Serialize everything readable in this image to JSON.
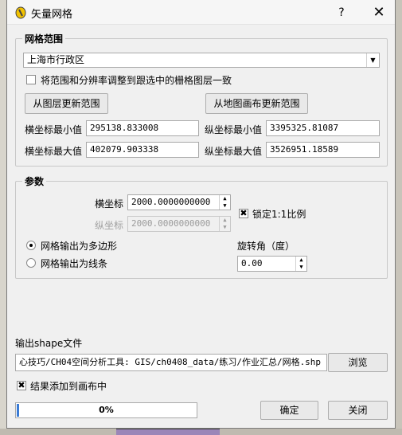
{
  "window": {
    "title": "矢量网格"
  },
  "titlebar": {
    "help_label": "?",
    "close_label": "✕"
  },
  "extent": {
    "group_title": "网格范围",
    "layer_combo_value": "上海市行政区",
    "match_raster_label": "将范围和分辨率调整到跟选中的栅格图层一致",
    "match_raster_checked": false,
    "update_from_layer_label": "从图层更新范围",
    "update_from_canvas_label": "从地图画布更新范围",
    "xmin_label": "横坐标最小值",
    "xmin_value": "295138.833008",
    "ymin_label": "纵坐标最小值",
    "ymin_value": "3395325.81087",
    "xmax_label": "横坐标最大值",
    "xmax_value": "402079.903338",
    "ymax_label": "纵坐标最大值",
    "ymax_value": "3526951.18589"
  },
  "params": {
    "group_title": "参数",
    "x_label": "横坐标",
    "x_value": "2000.0000000000",
    "y_label": "纵坐标",
    "y_value": "2000.0000000000",
    "lock_ratio_label": "锁定1:1比例",
    "lock_ratio_checked": true,
    "output_polygon_label": "网格输出为多边形",
    "output_polygon_selected": true,
    "output_line_label": "网格输出为线条",
    "output_line_selected": false,
    "rotation_label": "旋转角（度）",
    "rotation_value": "0.00"
  },
  "output": {
    "label": "输出shape文件",
    "path_value": "心技巧/CH04空间分析工具: GIS/ch0408_data/练习/作业汇总/网格.shp",
    "browse_label": "浏览",
    "add_to_canvas_label": "结果添加到画布中",
    "add_to_canvas_checked": true
  },
  "footer": {
    "progress_percent": 0,
    "progress_text": "0%",
    "ok_label": "确定",
    "close_label": "关闭"
  },
  "colors": {
    "progress_fill": "#3a7bd5",
    "dialog_bg": "#f0f0f0"
  }
}
